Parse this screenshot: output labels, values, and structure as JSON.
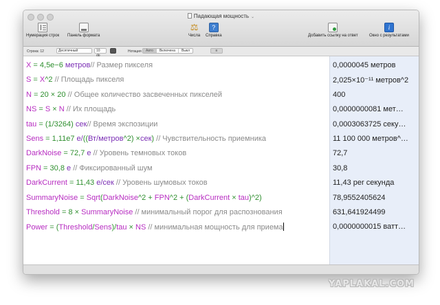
{
  "window": {
    "title": "Падающая мощность"
  },
  "toolbar": {
    "line_numbers": "Нумерация строк",
    "format_panel": "Панель формата",
    "numbers": "Числа",
    "help": "Справка",
    "add_link": "Добавить ссылку на ответ",
    "results_window": "Окно с результатами"
  },
  "options": {
    "line_label": "Строка: 12",
    "number_format": "Десятичный",
    "decimals": "10 dp",
    "notation_label": "Нотация",
    "notation_options": [
      "Авто",
      "Включена",
      "Выкл"
    ],
    "extra": "≡"
  },
  "colors": {
    "variable": "#b72dc1",
    "operator": "#2f8f2f",
    "number": "#2f8f2f",
    "unit": "#7b2fb5",
    "comment": "#8a8a8a",
    "default": "#333333"
  },
  "lines": [
    {
      "tokens": [
        [
          "v",
          "X"
        ],
        [
          "o",
          " = "
        ],
        [
          "n",
          "4,5e−6"
        ],
        [
          "u",
          " метров"
        ],
        [
          "c",
          "// Размер пикселя"
        ]
      ]
    },
    {
      "tokens": [
        [
          "v",
          "S"
        ],
        [
          "o",
          " = "
        ],
        [
          "v",
          "X"
        ],
        [
          "o",
          "^"
        ],
        [
          "n",
          "2"
        ],
        [
          "c",
          " // Площадь пикселя"
        ]
      ]
    },
    {
      "tokens": [
        [
          "v",
          "N"
        ],
        [
          "o",
          " = "
        ],
        [
          "n",
          "20"
        ],
        [
          "o",
          " × "
        ],
        [
          "n",
          "20"
        ],
        [
          "c",
          " // Общее количество засвеченных пикселей"
        ]
      ]
    },
    {
      "tokens": [
        [
          "v",
          "NS"
        ],
        [
          "o",
          " = "
        ],
        [
          "v",
          "S"
        ],
        [
          "o",
          " × "
        ],
        [
          "v",
          "N"
        ],
        [
          "c",
          " // Их площадь"
        ]
      ]
    },
    {
      "tokens": [
        [
          "v",
          "tau"
        ],
        [
          "o",
          " = ("
        ],
        [
          "n",
          "1/3264"
        ],
        [
          "o",
          ") "
        ],
        [
          "u",
          "сек"
        ],
        [
          "c",
          "// Время экспозиции"
        ]
      ]
    },
    {
      "tokens": [
        [
          "v",
          "Sens"
        ],
        [
          "o",
          " = "
        ],
        [
          "n",
          "1,11e7"
        ],
        [
          "u",
          " е/"
        ],
        [
          "o",
          "(("
        ],
        [
          "u",
          "Вт/метров"
        ],
        [
          "o",
          "^"
        ],
        [
          "n",
          "2"
        ],
        [
          "o",
          ") ×"
        ],
        [
          "u",
          "сек"
        ],
        [
          "o",
          ")"
        ],
        [
          "c",
          " // Чувствительность приемника"
        ]
      ]
    },
    {
      "tokens": [
        [
          "v",
          "DarkNoise"
        ],
        [
          "o",
          " = "
        ],
        [
          "n",
          "72,7"
        ],
        [
          "u",
          " е"
        ],
        [
          "c",
          " // Уровень темновых токов"
        ]
      ]
    },
    {
      "tokens": [
        [
          "v",
          "FPN"
        ],
        [
          "o",
          " = "
        ],
        [
          "n",
          "30,8"
        ],
        [
          "u",
          " е"
        ],
        [
          "c",
          " // Фиксированный шум"
        ]
      ]
    },
    {
      "tokens": [
        [
          "v",
          "DarkCurrent"
        ],
        [
          "o",
          " = "
        ],
        [
          "n",
          "11,43"
        ],
        [
          "u",
          " е/сек"
        ],
        [
          "c",
          " // Уровень шумовых токов"
        ]
      ]
    },
    {
      "tokens": [
        [
          "v",
          "SummaryNoise"
        ],
        [
          "o",
          " = "
        ],
        [
          "v",
          "Sqrt"
        ],
        [
          "o",
          "("
        ],
        [
          "v",
          "DarkNoise"
        ],
        [
          "o",
          "^"
        ],
        [
          "n",
          "2"
        ],
        [
          "o",
          " + "
        ],
        [
          "v",
          "FPN"
        ],
        [
          "o",
          "^"
        ],
        [
          "n",
          "2"
        ],
        [
          "o",
          " + ("
        ],
        [
          "v",
          "DarkCurrent"
        ],
        [
          "o",
          " × "
        ],
        [
          "v",
          "tau"
        ],
        [
          "o",
          ")^"
        ],
        [
          "n",
          "2"
        ],
        [
          "o",
          ")"
        ]
      ]
    },
    {
      "tokens": [
        [
          "v",
          "Threshold"
        ],
        [
          "o",
          " = "
        ],
        [
          "n",
          "8"
        ],
        [
          "o",
          " × "
        ],
        [
          "v",
          "SummaryNoise"
        ],
        [
          "c",
          " // минимальный порог для распознования"
        ]
      ]
    },
    {
      "tokens": [
        [
          "v",
          "Power"
        ],
        [
          "o",
          " = ("
        ],
        [
          "v",
          "Threshold"
        ],
        [
          "o",
          "/"
        ],
        [
          "v",
          "Sens"
        ],
        [
          "o",
          ")/"
        ],
        [
          "v",
          "tau"
        ],
        [
          "o",
          " × "
        ],
        [
          "v",
          "NS"
        ],
        [
          "c",
          " // минимальная мощность для приема"
        ]
      ],
      "cursor": true
    }
  ],
  "results": [
    "0,0000045 метров",
    "2,025×10⁻¹¹ метров^2",
    "400",
    "0,0000000081 мет…",
    "0,0003063725 секу…",
    "11 100 000 метров^…",
    "72,7",
    "30,8",
    "11,43 per секунда",
    "78,9552405624",
    "631,641924499",
    "0,0000000015 ватт…"
  ],
  "watermark": "YAPLAKAL.COM"
}
